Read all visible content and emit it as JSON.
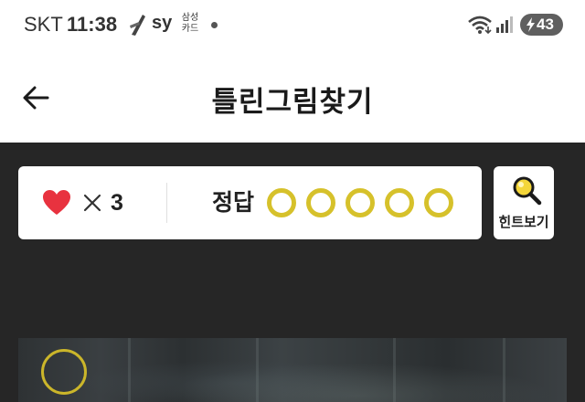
{
  "status_bar": {
    "carrier": "SKT",
    "time": "11:38",
    "app_label": "sy",
    "card_top": "삼성",
    "card_bottom": "카드",
    "battery": "43"
  },
  "header": {
    "title": "틀린그림찾기",
    "back_icon": "arrow-left-icon"
  },
  "game": {
    "lives_icon": "heart-icon",
    "lives_count": "3",
    "answer_label": "정답",
    "answer_slots": 5,
    "answers_found": 0,
    "hint_label": "힌트보기",
    "hint_icon": "magnifier-icon"
  },
  "colors": {
    "accent_yellow": "#d6c12b",
    "heart_red": "#e8323f",
    "game_background": "#262626"
  }
}
